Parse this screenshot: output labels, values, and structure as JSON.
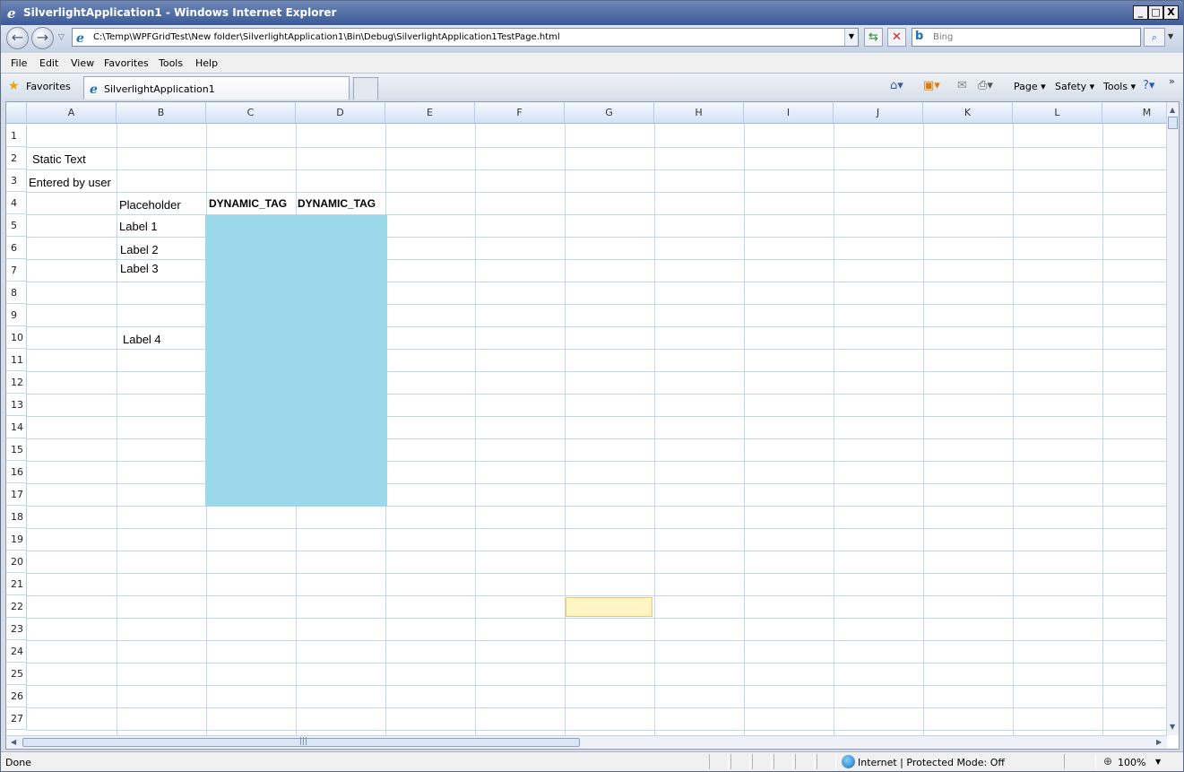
{
  "window": {
    "title": "SilverlightApplication1 - Windows Internet Explorer",
    "min_label": "_",
    "max_label": "□",
    "close_label": "X"
  },
  "address_bar": {
    "url": "C:\\Temp\\WPFGridTest\\New folder\\SilverlightApplication1\\Bin\\Debug\\SilverlightApplication1TestPage.html"
  },
  "search": {
    "placeholder": "Bing"
  },
  "menu": {
    "items": [
      "File",
      "Edit",
      "View",
      "Favorites",
      "Tools",
      "Help"
    ]
  },
  "favorites_bar": {
    "favorites_label": "Favorites",
    "tab_title": "SilverlightApplication1",
    "commands": [
      "Page ▾",
      "Safety ▾",
      "Tools ▾"
    ]
  },
  "spreadsheet": {
    "columns": [
      "A",
      "B",
      "C",
      "D",
      "E",
      "F",
      "G",
      "H",
      "I",
      "J",
      "K",
      "L",
      "M"
    ],
    "rows": [
      "1",
      "2",
      "3",
      "4",
      "5",
      "6",
      "7",
      "8",
      "9",
      "10",
      "11",
      "12",
      "13",
      "14",
      "15",
      "16",
      "17",
      "18",
      "19",
      "20",
      "21",
      "22",
      "23",
      "24",
      "25",
      "26",
      "27"
    ],
    "cells": {
      "a2": "Static Text",
      "a3": "Entered by user",
      "b4": "Placeholder",
      "c4": "DYNAMIC_TAG",
      "d4": "DYNAMIC_TAG",
      "b5": "Label 1",
      "b6": "Label 2",
      "b7": "Label 3",
      "b10": "Label 4"
    },
    "highlight_color": "#9bd8e9",
    "selected_cell": "G22"
  },
  "status_bar": {
    "status": "Done",
    "zone": "Internet | Protected Mode: Off",
    "zoom": "100%"
  }
}
